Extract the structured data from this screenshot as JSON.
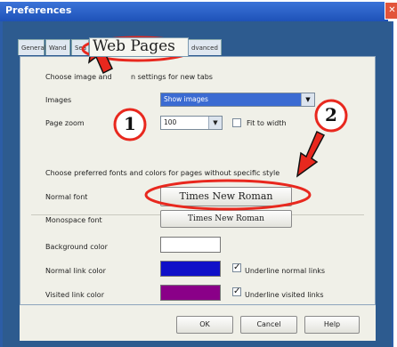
{
  "window": {
    "title": "Preferences",
    "close_glyph": "✕"
  },
  "tabs": [
    {
      "label": "General"
    },
    {
      "label": "Wand"
    },
    {
      "label": "Sea"
    },
    {
      "label": "Web Pages",
      "active": true
    },
    {
      "label": "dvanced"
    }
  ],
  "images_section": {
    "heading_left": "Choose image and",
    "heading_right": "n settings for new tabs",
    "images_label": "Images",
    "images_value": "Show images",
    "zoom_label": "Page zoom",
    "zoom_value": "100",
    "fit_label": "Fit to width"
  },
  "fonts_section": {
    "heading": "Choose preferred fonts and colors for pages without specific style",
    "normal_font_label": "Normal font",
    "normal_font_value": "Times New Roman",
    "mono_font_label": "Monospace font",
    "mono_font_value": "Times New Roman"
  },
  "colors_section": {
    "background_label": "Background color",
    "normal_link_label": "Normal link color",
    "underline_normal_label": "Underline normal links",
    "visited_link_label": "Visited link color",
    "underline_visited_label": "Underline visited links"
  },
  "colors": {
    "background_color": "#ffffff",
    "normal_link_color": "#1010c8",
    "visited_link_color": "#8a0088",
    "annotation_red": "#e8281e",
    "title_bar": "#2a5fc4"
  },
  "footer": {
    "ok": "OK",
    "cancel": "Cancel",
    "help": "Help"
  },
  "annotations": {
    "step1": "1",
    "step2": "2"
  }
}
